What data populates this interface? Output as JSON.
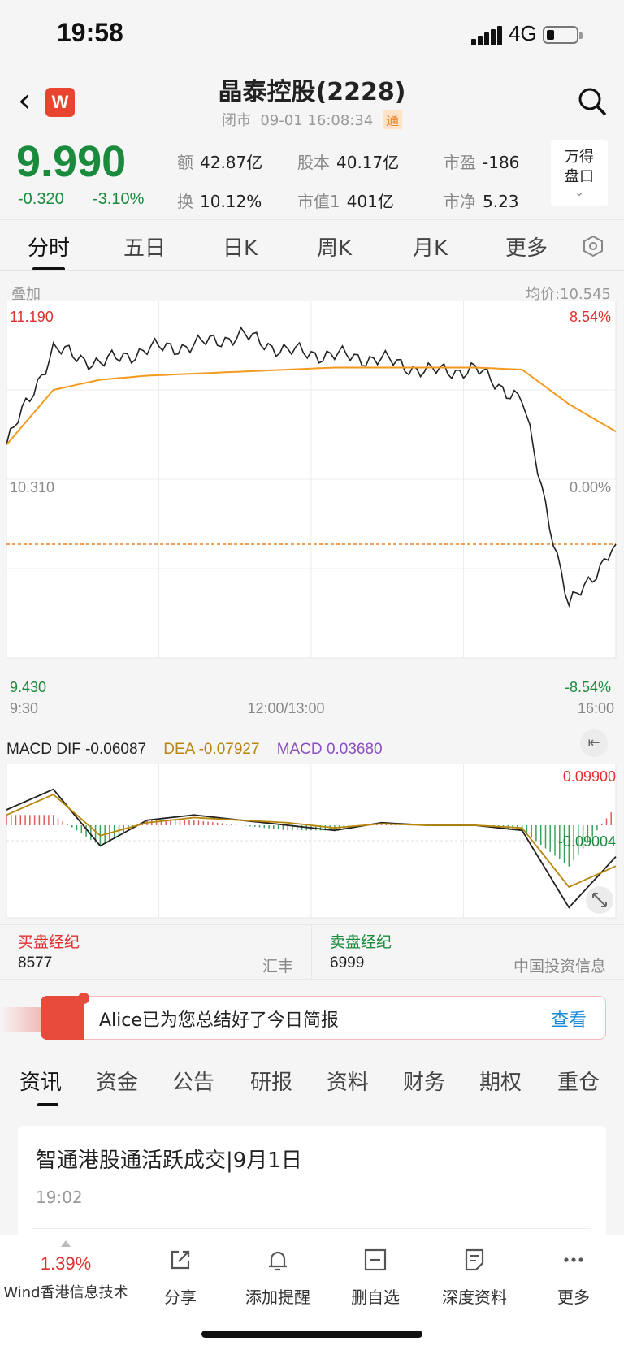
{
  "status_bar": {
    "time": "19:58",
    "network": "4G"
  },
  "header": {
    "back_icon": "chevron-left-icon",
    "logo_text": "W",
    "title": "晶泰控股(2228)",
    "status": "闭市",
    "datetime": "09-01 16:08:34",
    "badge": "通",
    "search_icon": "search-icon"
  },
  "quote": {
    "price": "9.990",
    "change": "-0.320",
    "change_pct": "-3.10%",
    "color_down": "#1a8a3c",
    "color_up": "#e03030",
    "stats": [
      {
        "key": "额",
        "value": "42.87亿"
      },
      {
        "key": "股本",
        "value": "40.17亿"
      },
      {
        "key": "市盈",
        "value": "-186"
      },
      {
        "key": "换",
        "value": "10.12%"
      },
      {
        "key": "市值1",
        "value": "401亿"
      },
      {
        "key": "市净",
        "value": "5.23"
      }
    ],
    "wd_button_line1": "万得",
    "wd_button_line2": "盘口"
  },
  "chart_tabs": [
    "分时",
    "五日",
    "日K",
    "周K",
    "月K",
    "更多"
  ],
  "chart_tabs_active": "分时",
  "settings_icon": "hexagon-settings-icon",
  "intraday": {
    "overlay_label": "叠加",
    "avg_price_label": "均价:10.545",
    "y_top": "11.190",
    "y_mid": "10.310",
    "y_bottom": "9.430",
    "pct_top": "8.54%",
    "pct_mid": "0.00%",
    "pct_bottom": "-8.54%",
    "x_labels": [
      "9:30",
      "12:00/13:00",
      "16:00"
    ],
    "price_color": "#222222",
    "avg_color": "#f39a1e",
    "last_close_color": "#f08020"
  },
  "chart_data": [
    {
      "type": "line",
      "title": "",
      "xlabel": "",
      "ylabel": "",
      "ylim": [
        9.43,
        11.19
      ],
      "x": [
        "9:30",
        "10:00",
        "10:30",
        "11:00",
        "11:30",
        "12:00/13:00",
        "13:30",
        "14:00",
        "14:30",
        "15:00",
        "15:30",
        "15:40",
        "15:50",
        "16:00"
      ],
      "series": [
        {
          "values": [
            10.48,
            10.95,
            10.88,
            10.95,
            10.97,
            11.02,
            10.94,
            10.92,
            10.9,
            10.84,
            10.85,
            10.7,
            9.68,
            9.99
          ]
        },
        {
          "values": [
            10.48,
            10.75,
            10.8,
            10.82,
            10.83,
            10.84,
            10.85,
            10.86,
            10.86,
            10.86,
            10.86,
            10.85,
            10.68,
            10.545
          ]
        }
      ],
      "reference_line": 9.99
    },
    {
      "type": "line",
      "title": "",
      "ylim": [
        -0.18,
        0.12
      ],
      "x": [
        "9:30",
        "10:00",
        "10:30",
        "11:00",
        "11:30",
        "12:00/13:00",
        "13:30",
        "14:00",
        "14:30",
        "15:00",
        "15:30",
        "15:40",
        "15:50",
        "16:00"
      ],
      "series": [
        {
          "name": "DIF",
          "values": [
            0.03,
            0.07,
            -0.04,
            0.01,
            0.02,
            0.01,
            0.0,
            -0.01,
            0.005,
            0.0,
            0.0,
            -0.01,
            -0.16,
            -0.06087
          ]
        },
        {
          "name": "DEA",
          "values": [
            0.02,
            0.06,
            -0.02,
            0.005,
            0.015,
            0.01,
            0.005,
            -0.005,
            0.003,
            0.0,
            0.0,
            -0.005,
            -0.12,
            -0.07927
          ]
        }
      ]
    }
  ],
  "macd": {
    "dif_label": "MACD DIF",
    "dif_value": "-0.06087",
    "dea_label": "DEA",
    "dea_value": "-0.07927",
    "macd_label": "MACD",
    "macd_value": "0.03680",
    "y_top": "0.09900",
    "y_bottom": "-0.09004",
    "dif_color": "#222222",
    "dea_color": "#b8860b",
    "macd_color": "#8b4fc0",
    "collapse_icon": "collapse-left-icon",
    "expand_icon": "expand-icon"
  },
  "brokers": {
    "buy_title": "买盘经纪",
    "buy_code": "8577",
    "buy_name": "汇丰",
    "sell_title": "卖盘经纪",
    "sell_code": "6999",
    "sell_name": "中国投资信息"
  },
  "banner": {
    "text": "Alice已为您总结好了今日简报",
    "link": "查看"
  },
  "news_tabs": [
    "资讯",
    "资金",
    "公告",
    "研报",
    "资料",
    "财务",
    "期权",
    "重仓"
  ],
  "news_tabs_active": "资讯",
  "news": [
    {
      "title": "智通港股通活跃成交|9月1日",
      "time": "19:02"
    }
  ],
  "bottom_bar": {
    "index_pct": "1.39%",
    "index_name": "Wind香港信息技术",
    "items": [
      {
        "label": "分享",
        "icon": "share-icon"
      },
      {
        "label": "添加提醒",
        "icon": "bell-icon"
      },
      {
        "label": "删自选",
        "icon": "remove-watchlist-icon"
      },
      {
        "label": "深度资料",
        "icon": "document-icon"
      },
      {
        "label": "更多",
        "icon": "more-dots-icon"
      }
    ]
  }
}
